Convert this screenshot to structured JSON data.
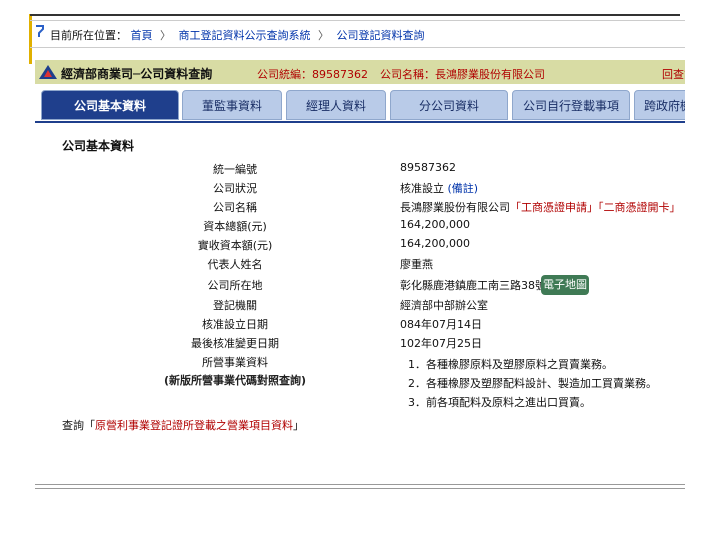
{
  "breadcrumb": {
    "prefix": "目前所在位置：",
    "items": [
      "首頁",
      "商工登記資料公示查詢系統",
      "公司登記資料查詢"
    ],
    "sep": "〉"
  },
  "header": {
    "title": "經濟部商業司─公司資料查詢",
    "company_no": "公司統編：89587362",
    "company_name": "公司名稱：長鴻膠業股份有限公司",
    "right_text": "回查詢"
  },
  "tabs": [
    "公司基本資料",
    "董監事資料",
    "經理人資料",
    "分公司資料",
    "公司自行登載事項",
    "跨政府機關"
  ],
  "section_title": "公司基本資料",
  "fields": [
    {
      "label": "統一編號",
      "value": "89587362"
    },
    {
      "label": "公司狀況",
      "value": "核准設立",
      "extra": "(備註)"
    },
    {
      "label": "公司名稱",
      "value": "長鴻膠業股份有限公司",
      "extra": "「工商憑證申請」「二商憑證開卡」"
    },
    {
      "label": "資本總額(元)",
      "value": "164,200,000"
    },
    {
      "label": "實收資本額(元)",
      "value": "164,200,000"
    },
    {
      "label": "代表人姓名",
      "value": "廖重燕"
    },
    {
      "label": "公司所在地",
      "value": "彰化縣鹿港鎮鹿工南三路38號",
      "button": "電子地圖"
    },
    {
      "label": "登記機關",
      "value": "經濟部中部辦公室"
    },
    {
      "label": "核准設立日期",
      "value": "084年07月14日"
    },
    {
      "label": "最後核准變更日期",
      "value": "102年07月25日"
    },
    {
      "label": "所營事業資料",
      "value": ""
    }
  ],
  "business_note": "(新版所營事業代碼對照查詢)",
  "business_items": [
    "1．各種橡膠原料及塑膠原料之買賣業務。",
    "2．各種橡膠及塑膠配料設計、製造加工買賣業務。",
    "3．前各項配料及原料之進出口買賣。"
  ],
  "query_line": {
    "prefix": "查詢「",
    "link": "原營利事業登記證所登載之營業項目資料",
    "suffix": "」"
  }
}
